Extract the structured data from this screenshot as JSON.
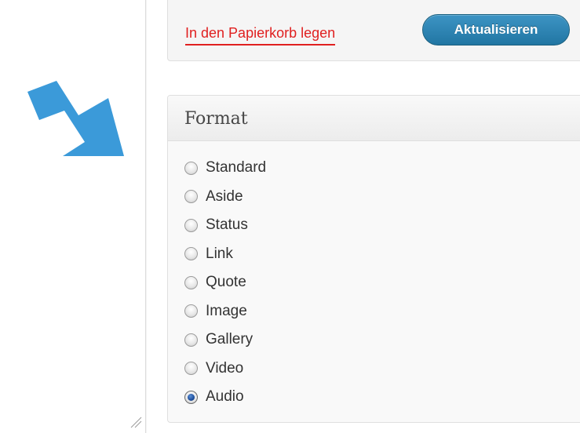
{
  "publish": {
    "trash_label": "In den Papierkorb legen",
    "update_label": "Aktualisieren"
  },
  "format_box": {
    "title": "Format",
    "options": [
      {
        "label": "Standard",
        "checked": false
      },
      {
        "label": "Aside",
        "checked": false
      },
      {
        "label": "Status",
        "checked": false
      },
      {
        "label": "Link",
        "checked": false
      },
      {
        "label": "Quote",
        "checked": false
      },
      {
        "label": "Image",
        "checked": false
      },
      {
        "label": "Gallery",
        "checked": false
      },
      {
        "label": "Video",
        "checked": false
      },
      {
        "label": "Audio",
        "checked": true
      }
    ]
  },
  "annotation": {
    "arrow_icon": "arrow-right-icon",
    "arrow_color": "#3b9ad9"
  },
  "colors": {
    "trash_link": "#e02020",
    "button_primary": "#2176a3"
  }
}
